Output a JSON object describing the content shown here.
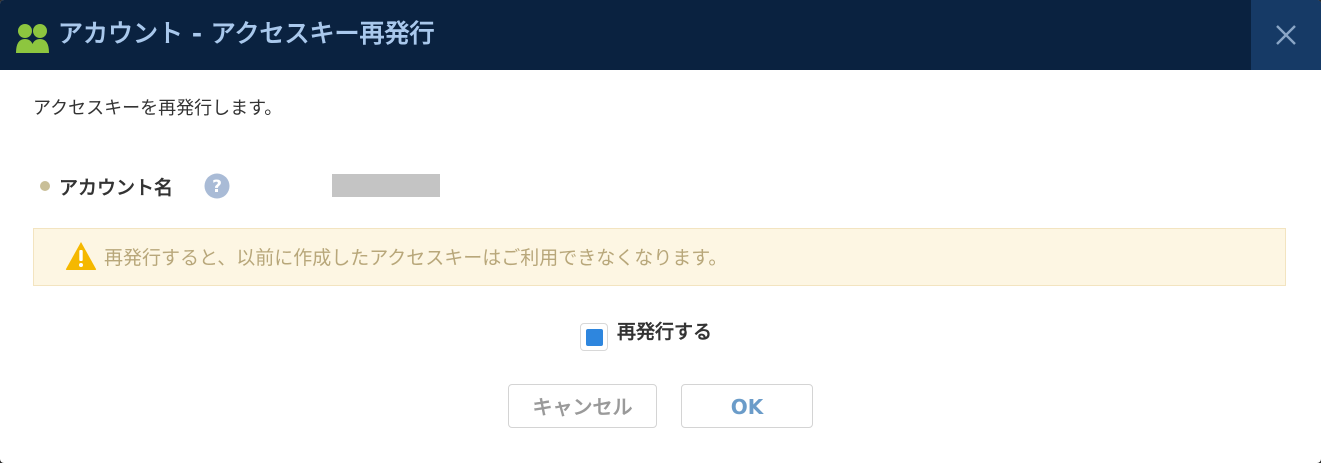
{
  "dialog": {
    "title": "アカウント - アクセスキー再発行",
    "description": "アクセスキーを再発行します。",
    "field": {
      "label": "アカウント名",
      "value_redacted": true
    },
    "warning": "再発行すると、以前に作成したアクセスキーはご利用できなくなります。",
    "checkbox": {
      "label": "再発行する",
      "checked": true
    },
    "buttons": {
      "cancel": "キャンセル",
      "ok": "OK"
    }
  },
  "icons": {
    "title": "users-icon",
    "close": "close-icon",
    "help": "help-icon",
    "warning": "warning-icon"
  },
  "colors": {
    "titlebar_bg": "#0a2240",
    "title_text": "#a9c8ec",
    "close_bg": "#163a66",
    "warning_bg": "#fdf6e3",
    "warning_text": "#b8a77a",
    "checkbox_accent": "#2e86de",
    "ok_text": "#6b9cc9",
    "users_icon": "#8dc63f"
  }
}
